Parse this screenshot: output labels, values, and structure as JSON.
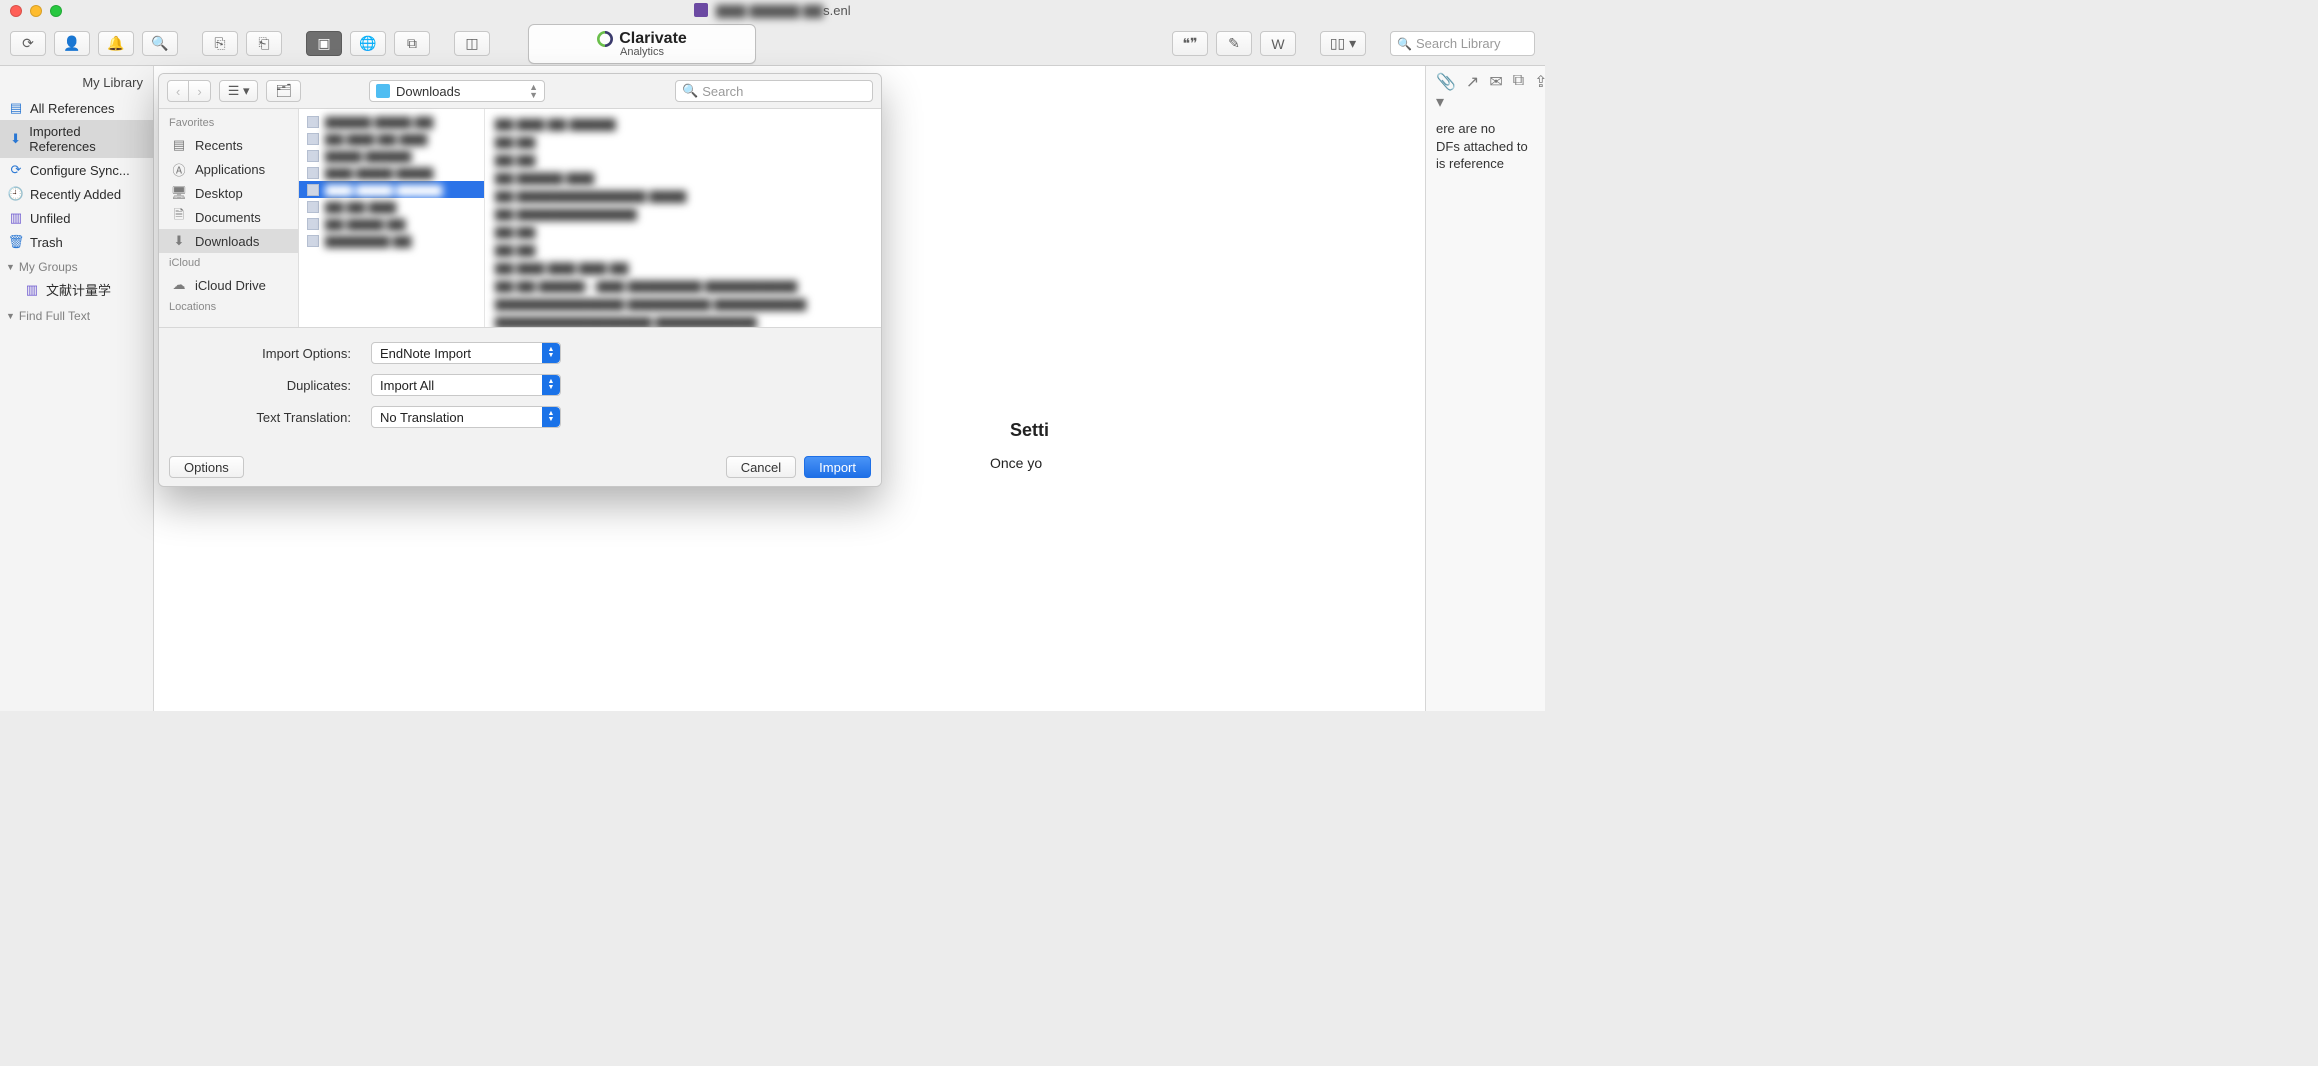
{
  "window": {
    "title_file": "s.enl",
    "traffic": [
      "close",
      "minimize",
      "zoom"
    ]
  },
  "toolbar": {
    "sync_icon": "sync",
    "share_icon": "user-plus",
    "alerts_icon": "bell",
    "analyze_icon": "chart",
    "export_icon": "export",
    "import_icon": "import",
    "local_icon": "folder",
    "online_icon": "globe",
    "openurl_icon": "openurl",
    "window_icon": "window",
    "quote_icon": "quote",
    "edit_icon": "edit",
    "word_icon": "word",
    "layout_icon": "layout",
    "brand_top": "Clarivate",
    "brand_sub": "Analytics",
    "search_placeholder": "Search Library"
  },
  "sidebar": {
    "header": "My Library",
    "items": [
      {
        "icon": "box",
        "label": "All References",
        "color": "bc-blue"
      },
      {
        "icon": "down",
        "label": "Imported References",
        "color": "bc-blue",
        "selected": true
      },
      {
        "icon": "sync",
        "label": "Configure Sync...",
        "color": "bc-blue"
      },
      {
        "icon": "clock",
        "label": "Recently Added",
        "color": "bc-blue"
      },
      {
        "icon": "doc",
        "label": "Unfiled",
        "color": "bc-purple"
      },
      {
        "icon": "trash",
        "label": "Trash",
        "color": "bc-blue"
      }
    ],
    "group_my_groups": "My Groups",
    "group_item": "文献计量学",
    "group_find_full_text": "Find Full Text"
  },
  "rpanel": {
    "icons": [
      "clip",
      "ext",
      "mail",
      "copy",
      "share"
    ],
    "msg": "ere are no\nDFs attached to\nis reference"
  },
  "finder": {
    "nav_back": "‹",
    "nav_fwd": "›",
    "nav_view": "col",
    "nav_newfolder": "newfolder",
    "location": "Downloads",
    "search_placeholder": "Search",
    "favorites_label": "Favorites",
    "locations_label": "Locations",
    "icloud_label": "iCloud",
    "favorites": [
      {
        "icon": "recents",
        "label": "Recents"
      },
      {
        "icon": "apps",
        "label": "Applications"
      },
      {
        "icon": "desk",
        "label": "Desktop"
      },
      {
        "icon": "docs",
        "label": "Documents"
      },
      {
        "icon": "down",
        "label": "Downloads",
        "selected": true
      }
    ],
    "icloud": [
      {
        "icon": "cloud",
        "label": "iCloud Drive"
      }
    ],
    "files": [
      "▇▇▇▇▇ ▇▇▇▇.▇▇",
      "▇▇ ▇▇▇ ▇▇ ▇▇▇",
      "▇▇▇▇ ▇▇▇▇▇",
      "▇▇▇ ▇▇▇▇ ▇▇▇▇",
      "▇▇▇ ▇▇▇▇ ▇▇▇▇▇",
      "▇▇ ▇▇ ▇▇▇",
      "▇▇ ▇▇▇▇ ▇▇",
      "▇▇▇▇▇▇▇ ▇▇"
    ],
    "selected_file_index": 4,
    "preview_lines": [
      "▇▇ ▇▇▇ ▇▇ ▇▇▇▇▇",
      "▇▇ ▇▇",
      "▇▇ ▇▇",
      "▇▇  ▇▇▇▇▇ ▇▇▇",
      "▇▇ ▇▇▇▇▇▇▇▇▇▇▇▇▇▇ ▇▇▇▇",
      "▇▇ ▇▇▇▇▇▇▇▇▇▇▇▇▇",
      "▇▇ ▇▇",
      "▇▇ ▇▇",
      "▇▇ ▇▇▇ ▇▇▇  ▇▇▇ ▇▇",
      "▇▇ ▇▇ ▇▇▇▇▇—▇▇▇ ▇▇▇▇▇▇▇▇ ▇▇▇▇▇▇▇▇▇▇",
      "▇▇▇▇▇▇▇▇▇▇▇▇▇▇ ▇▇▇▇▇▇▇▇▇ ▇▇▇▇▇▇▇▇▇▇",
      "▇▇▇▇▇▇▇▇▇▇▇▇▇▇▇▇▇ ▇▇▇▇▇▇▇▇▇▇▇"
    ],
    "options": {
      "import_options_label": "Import Options:",
      "import_options_value": "EndNote Import",
      "duplicates_label": "Duplicates:",
      "duplicates_value": "Import All",
      "text_translation_label": "Text Translation:",
      "text_translation_value": "No Translation"
    },
    "buttons": {
      "options": "Options",
      "cancel": "Cancel",
      "import": "Import"
    }
  },
  "extra": {
    "heading": "Setti",
    "para": "Once yo"
  }
}
